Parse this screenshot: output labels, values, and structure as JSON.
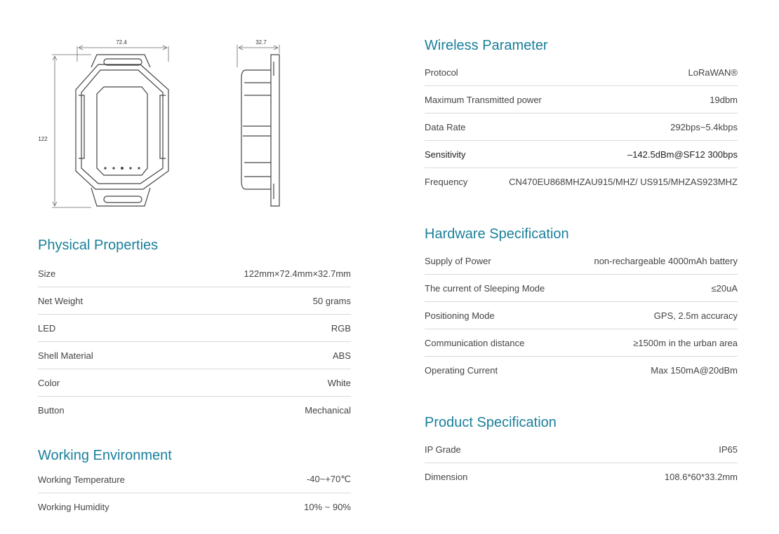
{
  "drawing": {
    "dim_width": "72.4",
    "dim_depth": "32.7",
    "dim_height": "122"
  },
  "physical": {
    "title": "Physical Properties",
    "rows": [
      {
        "label": "Size",
        "value": "122mm×72.4mm×32.7mm"
      },
      {
        "label": "Net Weight",
        "value": "50 grams"
      },
      {
        "label": "LED",
        "value": "RGB"
      },
      {
        "label": "Shell Material",
        "value": "ABS"
      },
      {
        "label": "Color",
        "value": "White"
      },
      {
        "label": "Button",
        "value": "Mechanical"
      }
    ]
  },
  "environment": {
    "title": "Working Environment",
    "rows": [
      {
        "label": "Working Temperature",
        "value": "-40~+70℃"
      },
      {
        "label": "Working Humidity",
        "value": "10% ~ 90%"
      }
    ]
  },
  "wireless": {
    "title": "Wireless Parameter",
    "rows": [
      {
        "label": "Protocol",
        "value": "LoRaWAN®"
      },
      {
        "label": "Maximum Transmitted power",
        "value": "19dbm"
      },
      {
        "label": "Data Rate",
        "value": "292bps~5.4kbps"
      },
      {
        "label": "Sensitivity",
        "value": "–142.5dBm@SF12 300bps"
      },
      {
        "label": "Frequency",
        "value": "CN470EU868MHZAU915/MHZ/ US915/MHZAS923MHZ"
      }
    ]
  },
  "hardware": {
    "title": "Hardware Specification",
    "rows": [
      {
        "label": "Supply of Power",
        "value": "non-rechargeable 4000mAh battery"
      },
      {
        "label": "The current of Sleeping Mode",
        "value": "≤20uA"
      },
      {
        "label": "Positioning Mode",
        "value": "GPS, 2.5m accuracy"
      },
      {
        "label": "Communication distance",
        "value": "≥1500m in the urban area"
      },
      {
        "label": "Operating Current",
        "value": "Max 150mA@20dBm"
      }
    ]
  },
  "product": {
    "title": "Product Specification",
    "rows": [
      {
        "label": "IP Grade",
        "value": "IP65"
      },
      {
        "label": "Dimension",
        "value": "108.6*60*33.2mm"
      }
    ]
  }
}
